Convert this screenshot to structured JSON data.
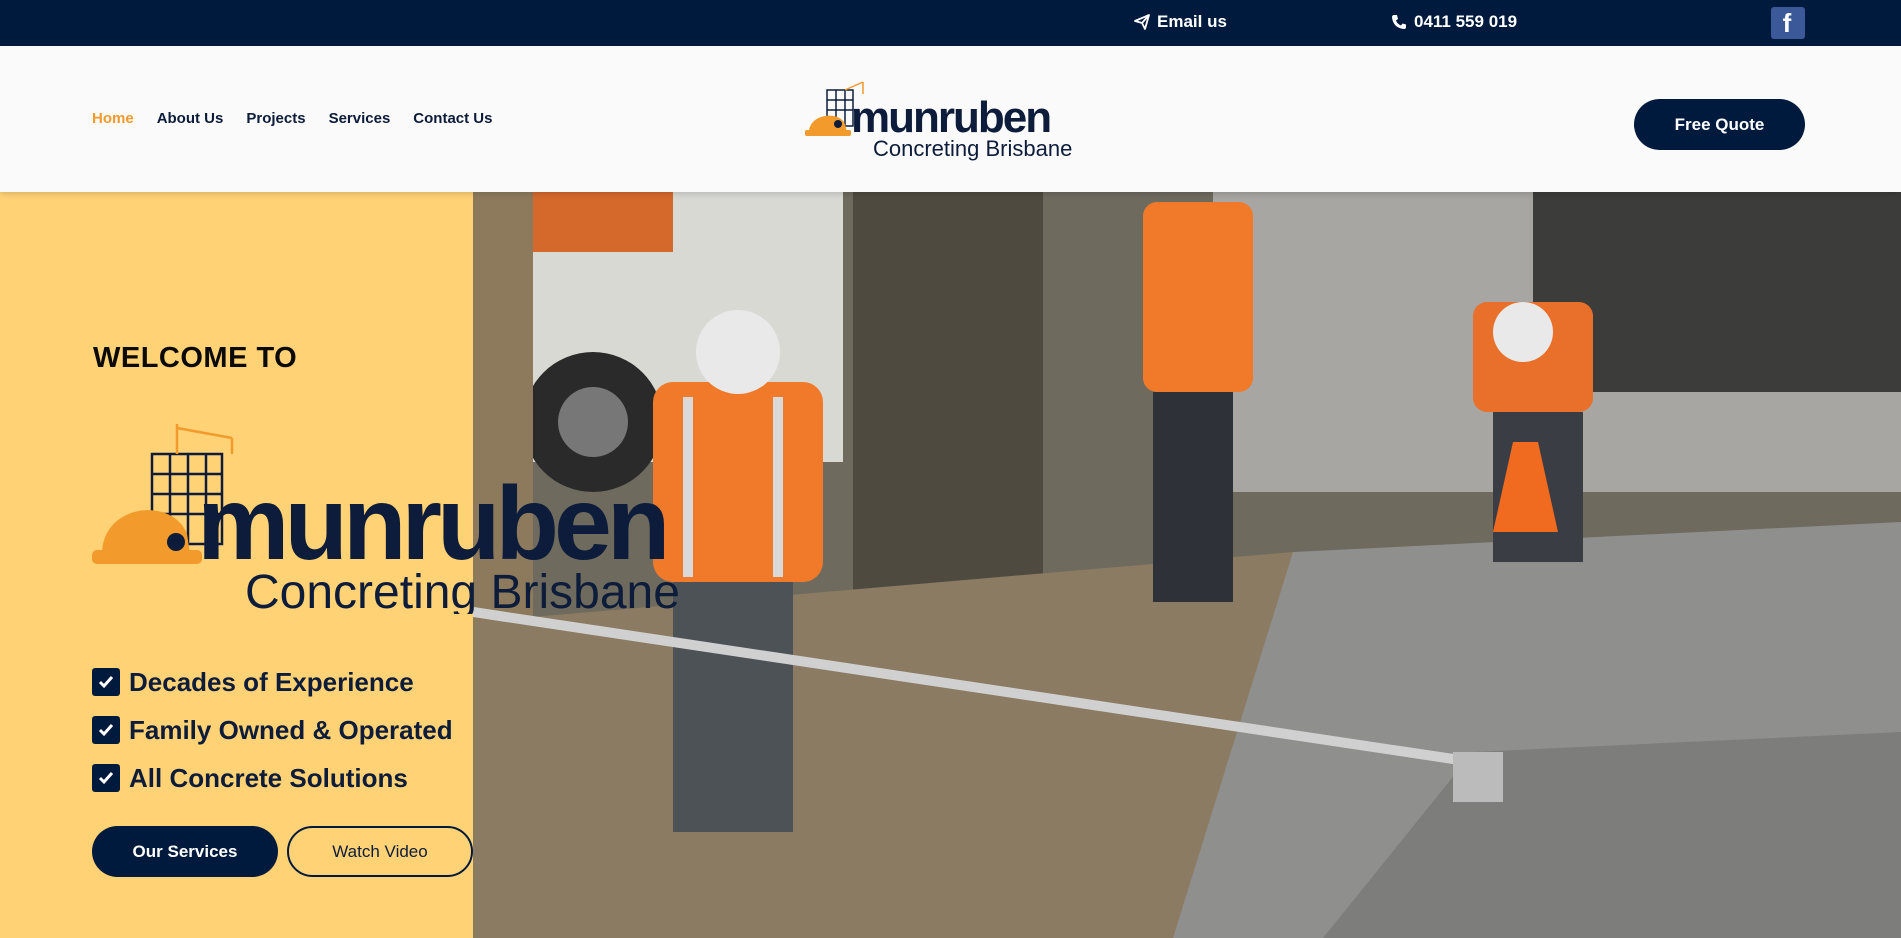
{
  "topbar": {
    "email_label": "Email us",
    "phone_label": "0411 559 019",
    "facebook_glyph": "f"
  },
  "nav": {
    "items": [
      {
        "label": "Home",
        "active": true
      },
      {
        "label": "About Us"
      },
      {
        "label": "Projects"
      },
      {
        "label": "Services"
      },
      {
        "label": "Contact Us"
      }
    ]
  },
  "header": {
    "cta_label": "Free Quote"
  },
  "logo": {
    "brand": "munruben",
    "tagline": "Concreting Brisbane"
  },
  "hero": {
    "welcome": "WELCOME TO",
    "features": [
      "Decades of Experience",
      "Family Owned & Operated",
      "All Concrete Solutions"
    ],
    "primary_button": "Our Services",
    "secondary_button": "Watch Video"
  },
  "colors": {
    "navy": "#001a3d",
    "orange": "#f39a2c",
    "yellow_panel": "#ffd275"
  },
  "icons": [
    "paper-plane-icon",
    "phone-icon",
    "facebook-icon",
    "checkbox-icon",
    "hardhat-icon",
    "building-icon"
  ]
}
